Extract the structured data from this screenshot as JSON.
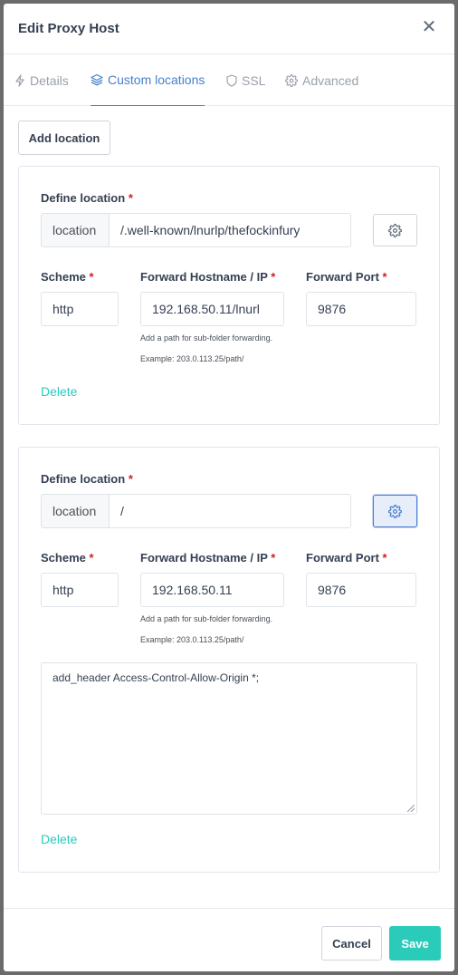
{
  "modal": {
    "title": "Edit Proxy Host",
    "close_glyph": "✕"
  },
  "tabs": [
    {
      "label": "Details",
      "icon": "bolt-icon",
      "active": false
    },
    {
      "label": "Custom locations",
      "icon": "layers-icon",
      "active": true
    },
    {
      "label": "SSL",
      "icon": "shield-icon",
      "active": false
    },
    {
      "label": "Advanced",
      "icon": "gear-icon",
      "active": false
    }
  ],
  "add_location_label": "Add location",
  "required_mark": "*",
  "locations": [
    {
      "define_label": "Define location",
      "prepend": "location",
      "path": "/.well-known/lnurlp/thefockinfury",
      "scheme_label": "Scheme",
      "scheme": "http",
      "host_label": "Forward Hostname / IP",
      "host": "192.168.50.11/lnurl",
      "port_label": "Forward Port",
      "port": "9876",
      "hint_line1": "Add a path for sub-folder forwarding.",
      "hint_line2": "Example: 203.0.113.25/path/",
      "advanced_open": false,
      "delete_label": "Delete"
    },
    {
      "define_label": "Define location",
      "prepend": "location",
      "path": "/",
      "scheme_label": "Scheme",
      "scheme": "http",
      "host_label": "Forward Hostname / IP",
      "host": "192.168.50.11",
      "port_label": "Forward Port",
      "port": "9876",
      "hint_line1": "Add a path for sub-folder forwarding.",
      "hint_line2": "Example: 203.0.113.25/path/",
      "advanced_open": true,
      "advanced_config": "add_header Access-Control-Allow-Origin *;",
      "delete_label": "Delete"
    }
  ],
  "footer": {
    "cancel_label": "Cancel",
    "save_label": "Save"
  },
  "colors": {
    "accent": "#467fcf",
    "teal": "#2bcbba",
    "required": "#cd201f"
  }
}
